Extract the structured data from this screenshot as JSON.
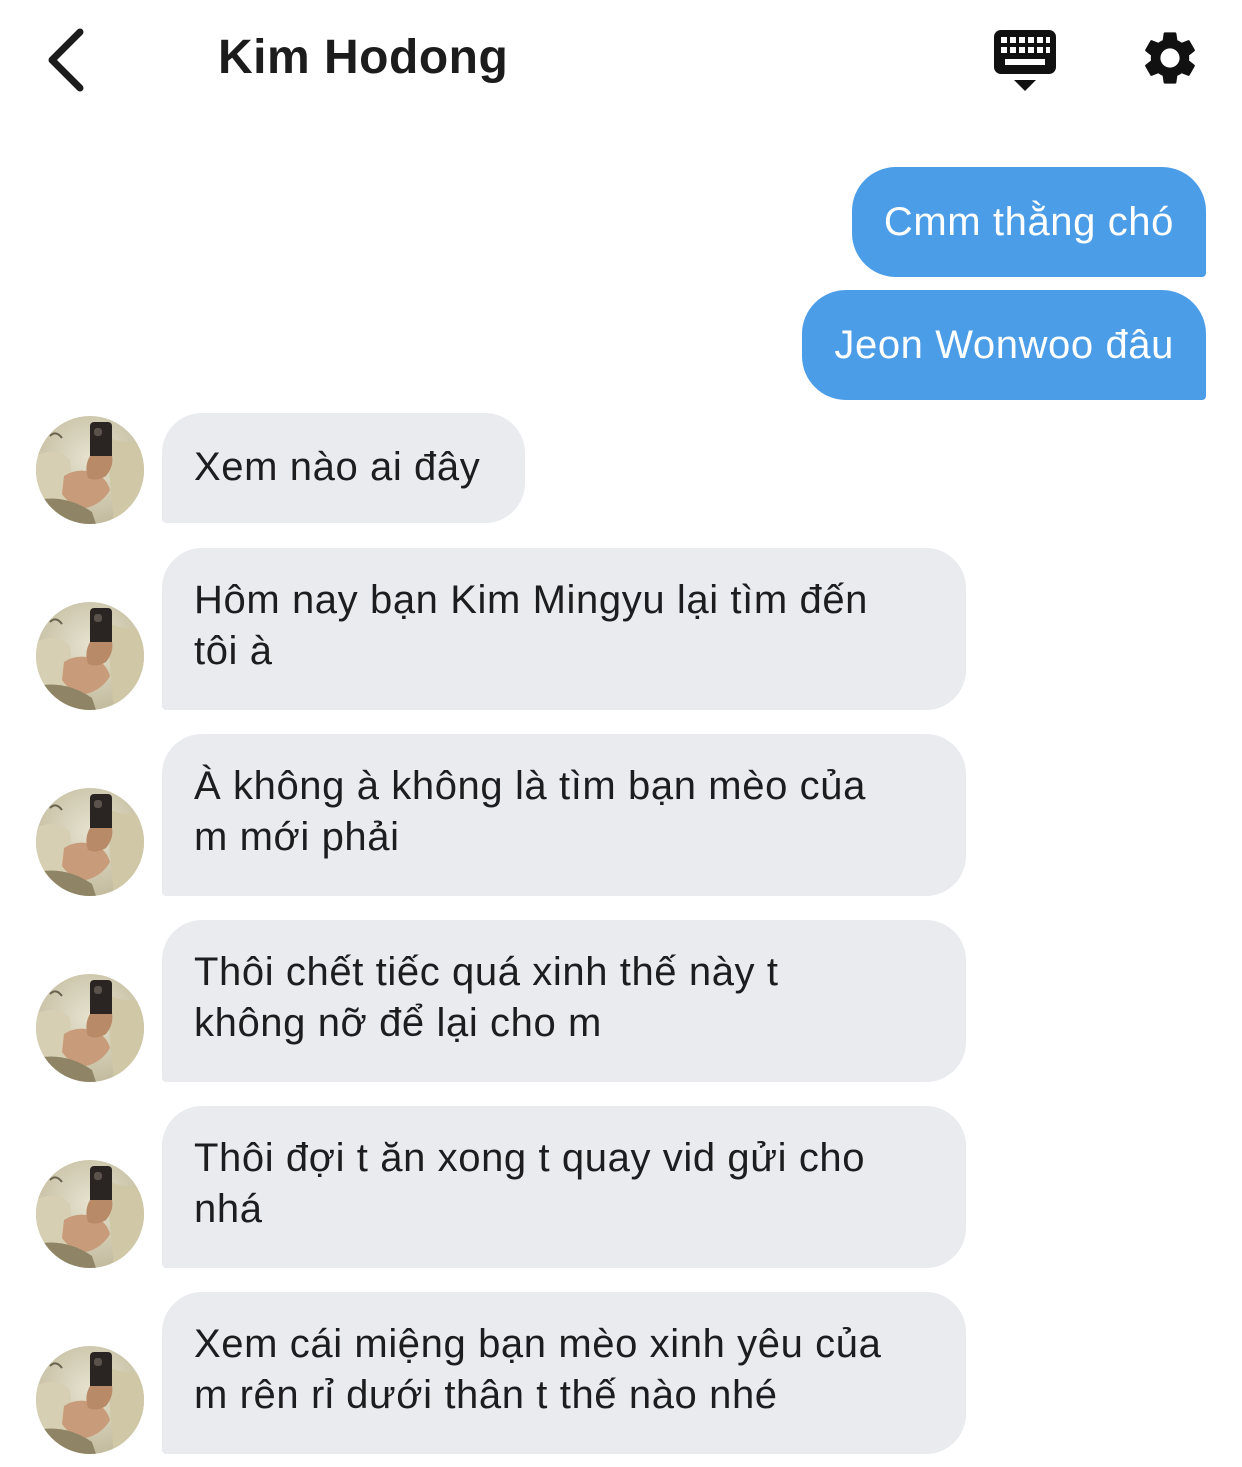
{
  "header": {
    "title": "Kim Hodong"
  },
  "icons": {
    "back": "chevron-left-icon",
    "keyboard": "keyboard-icon",
    "settings": "gear-icon"
  },
  "colors": {
    "outgoing_bubble": "#4b9de8",
    "incoming_bubble": "#e9ebef"
  },
  "messages": [
    {
      "sender": "me",
      "text": "Cmm thằng chó"
    },
    {
      "sender": "me",
      "text": "Jeon Wonwoo đâu"
    },
    {
      "sender": "other",
      "text": "Xem nào ai đây"
    },
    {
      "sender": "other",
      "line1": "Hôm nay bạn Kim Mingyu lại tìm đến",
      "line2": "tôi à"
    },
    {
      "sender": "other",
      "line1": "À không à không là tìm bạn mèo của",
      "line2": "m mới phải"
    },
    {
      "sender": "other",
      "line1": "Thôi chết tiếc quá xinh thế này t",
      "line2": "không nỡ để lại cho m"
    },
    {
      "sender": "other",
      "line1": "Thôi đợi t ăn xong t quay vid gửi cho",
      "line2": "nhá"
    },
    {
      "sender": "other",
      "line1": "Xem cái miệng bạn mèo xinh yêu của",
      "line2": "m rên rỉ dưới thân t thế nào nhé"
    }
  ]
}
